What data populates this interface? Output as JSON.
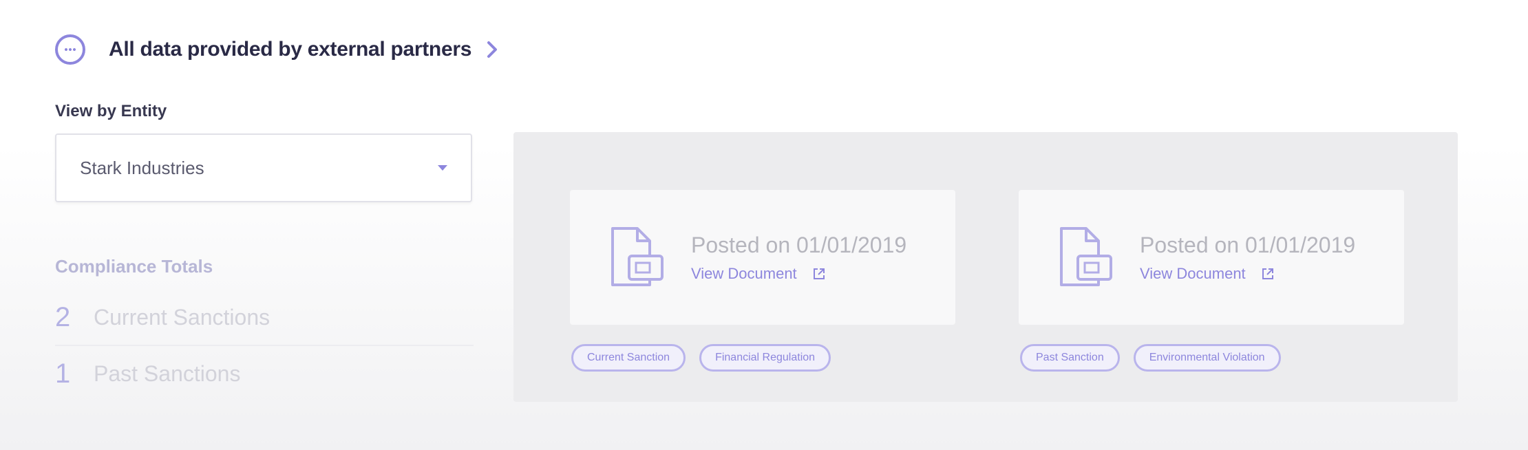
{
  "notice": {
    "text": "All data provided by external partners",
    "icon": "info-dots-icon",
    "chevron_icon": "chevron-right-icon"
  },
  "entity": {
    "label": "View by Entity",
    "selected": "Stark Industries"
  },
  "totals": {
    "title": "Compliance Totals",
    "rows": [
      {
        "count": "2",
        "label": "Current Sanctions"
      },
      {
        "count": "1",
        "label": "Past Sanctions"
      }
    ]
  },
  "documents": [
    {
      "posted": "Posted on 01/01/2019",
      "link": "View Document",
      "tags": [
        "Current Sanction",
        "Financial Regulation"
      ]
    },
    {
      "posted": "Posted on 01/01/2019",
      "link": "View Document",
      "tags": [
        "Past Sanction",
        "Environmental Violation"
      ]
    }
  ],
  "colors": {
    "accent": "#8d86dd",
    "panel_bg": "#ececee",
    "card_bg": "#f8f8f9"
  }
}
